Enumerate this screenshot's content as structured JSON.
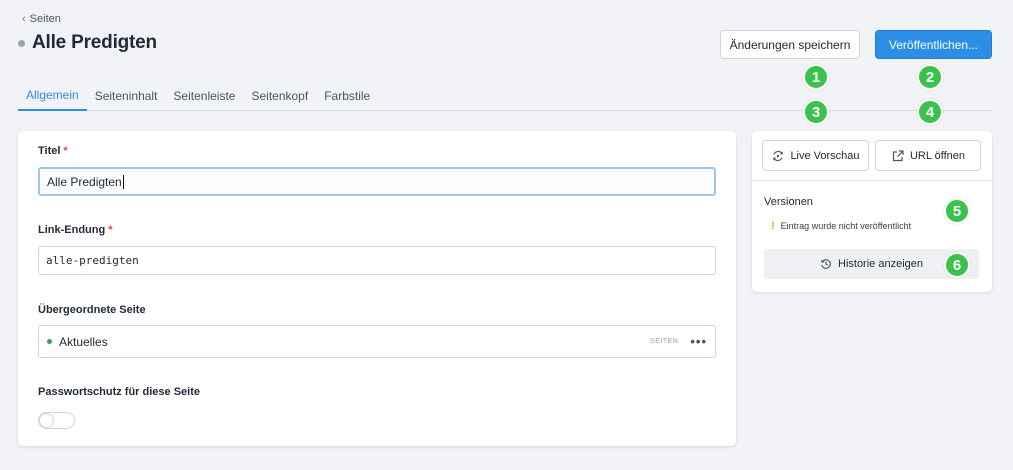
{
  "breadcrumb": {
    "label": "Seiten"
  },
  "page": {
    "title": "Alle Predigten"
  },
  "header": {
    "save_label": "Änderungen speichern",
    "publish_label": "Veröffentlichen..."
  },
  "tabs": [
    {
      "label": "Allgemein",
      "active": true
    },
    {
      "label": "Seiteninhalt"
    },
    {
      "label": "Seitenleiste"
    },
    {
      "label": "Seitenkopf"
    },
    {
      "label": "Farbstile"
    }
  ],
  "form": {
    "title_label": "Titel",
    "title_value": "Alle Predigten",
    "required_mark": "*",
    "slug_label": "Link-Endung",
    "slug_value": "alle-predigten",
    "parent_label": "Übergeordnete Seite",
    "parent_value": "Aktuelles",
    "parent_type": "SEITEN",
    "parent_more": "•••",
    "password_label": "Passwortschutz für diese Seite",
    "password_enabled": false
  },
  "sidebar": {
    "preview_label": "Live Vorschau",
    "url_label": "URL öffnen",
    "versions_title": "Versionen",
    "notice_mark": "!",
    "notice_text": "Eintrag wurde nicht veröffentlicht",
    "history_label": "Historie anzeigen"
  },
  "badges": [
    "1",
    "2",
    "3",
    "4",
    "5",
    "6"
  ],
  "colors": {
    "accent": "#2b8fe8",
    "badge": "#3ac24b",
    "required": "#e53e3e",
    "warning": "#f59e0b"
  }
}
